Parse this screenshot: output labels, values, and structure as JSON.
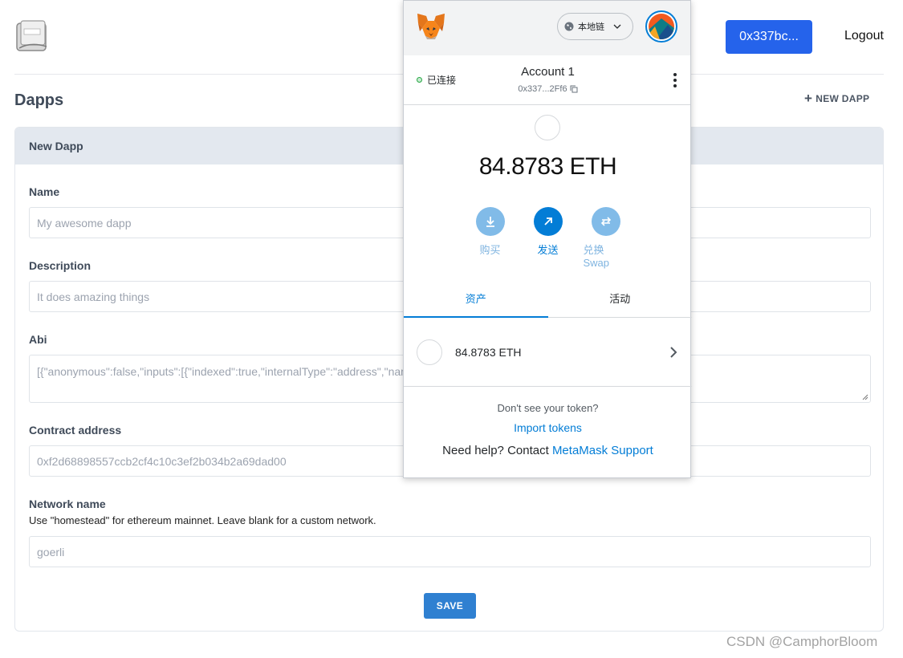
{
  "header": {
    "account_button": "0x337bc...",
    "logout": "Logout"
  },
  "page": {
    "title": "Dapps",
    "new_dapp": "NEW DAPP"
  },
  "form": {
    "card_title": "New Dapp",
    "name": {
      "label": "Name",
      "placeholder": "My awesome dapp"
    },
    "description": {
      "label": "Description",
      "placeholder": "It does amazing things"
    },
    "abi": {
      "label": "Abi",
      "value": "[{\"anonymous\":false,\"inputs\":[{\"indexed\":true,\"internalType\":\"address\",\"nam"
    },
    "contract_address": {
      "label": "Contract address",
      "value": "0xf2d68898557ccb2cf4c10c3ef2b034b2a69dad00"
    },
    "network_name": {
      "label": "Network name",
      "hint": "Use \"homestead\" for ethereum mainnet. Leave blank for a custom network.",
      "value": "goerli"
    },
    "save": "SAVE"
  },
  "metamask": {
    "network": "本地链",
    "connected": "已连接",
    "account_name": "Account 1",
    "address": "0x337...2Ff6",
    "balance": "84.8783 ETH",
    "actions": [
      {
        "label": "购买",
        "icon": "download-icon"
      },
      {
        "label": "发送",
        "icon": "send-arrow-icon"
      },
      {
        "label": "兑换 Swap",
        "icon": "swap-icon"
      }
    ],
    "tabs": [
      "资产",
      "活动"
    ],
    "asset": {
      "amount": "84.8783",
      "symbol": "ETH"
    },
    "footer": {
      "question": "Don't see your token?",
      "import_tokens": "Import tokens",
      "help_prefix": "Need help? Contact",
      "support_link": "MetaMask Support"
    },
    "accent_color": "#037dd6"
  },
  "watermark": "CSDN @CamphorBloom"
}
